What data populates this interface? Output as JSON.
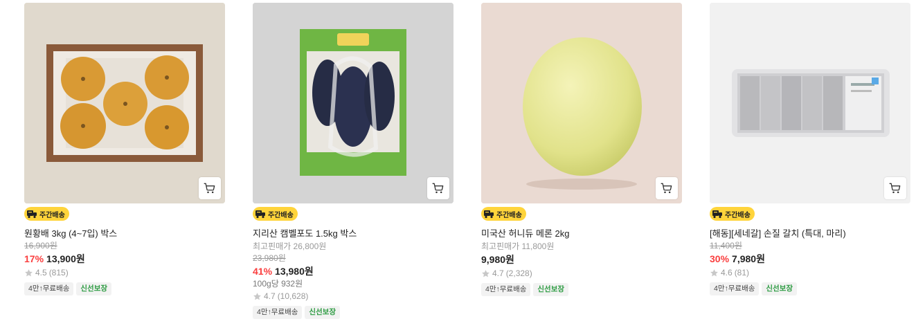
{
  "products": [
    {
      "badge": "주간배송",
      "title": "원황배 3kg (4~7입) 박스",
      "original_price": "16,900원",
      "discount": "17%",
      "price": "13,900원",
      "rating": "4.5",
      "reviews": "(815)",
      "tag_shipping": "4만↑무료배송",
      "tag_fresh": "신선보장"
    },
    {
      "badge": "주간배송",
      "title": "지리산 캠벨포도 1.5kg 박스",
      "lowest_price": "최고핀매가 26,800원",
      "original_price": "23,980원",
      "discount": "41%",
      "price": "13,980원",
      "unit_price": "100g당 932원",
      "rating": "4.7",
      "reviews": "(10,628)",
      "tag_shipping": "4만↑무료배송",
      "tag_fresh": "신선보장"
    },
    {
      "badge": "주간배송",
      "title": "미국산 허니듀 메론 2kg",
      "lowest_price": "최고핀매가 11,800원",
      "price": "9,980원",
      "rating": "4.7",
      "reviews": "(2,328)",
      "tag_shipping": "4만↑무료배송",
      "tag_fresh": "신선보장"
    },
    {
      "badge": "주간배송",
      "title": "[해동][세네갈] 손질 갈치 (특대, 마리)",
      "original_price": "11,400원",
      "discount": "30%",
      "price": "7,980원",
      "rating": "4.6",
      "reviews": "(81)",
      "tag_shipping": "4만↑무료배송",
      "tag_fresh": "신선보장"
    }
  ],
  "icons": {
    "cart": "cart-icon",
    "star": "star-icon",
    "delivery": "delivery-truck-icon"
  },
  "colors": {
    "discount": "#fa3e3e",
    "badge": "#ffd43b",
    "fresh_tag": "#2c9b41"
  }
}
